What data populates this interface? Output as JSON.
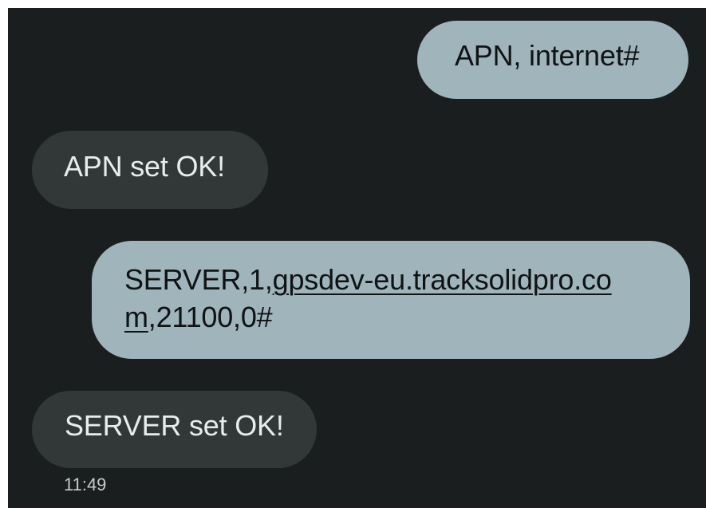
{
  "messages": [
    {
      "direction": "sent",
      "text": "APN, internet#"
    },
    {
      "direction": "received",
      "text": "APN set OK!"
    },
    {
      "direction": "sent",
      "prefix": "SERVER,1,",
      "link_line1": "gpsdev-eu.tracksolidpro.co",
      "link_line2": "m",
      "suffix": ",21100,0#"
    },
    {
      "direction": "received",
      "text": "SERVER set OK!"
    }
  ],
  "timestamp": "11:49",
  "colors": {
    "background": "#1b1e1f",
    "sent_bubble": "#a0b4bc",
    "received_bubble": "#323738",
    "sent_text": "#0f1314",
    "received_text": "#e9ecec"
  }
}
